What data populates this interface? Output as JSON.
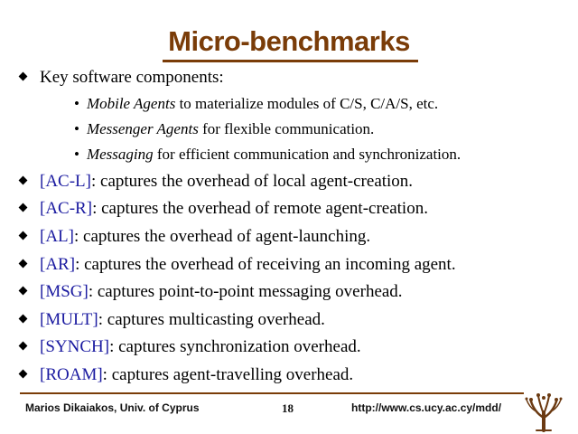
{
  "title": "Micro-benchmarks",
  "intro": "Key software components:",
  "sub_items": [
    {
      "term": "Mobile Agents",
      "text": " to materialize modules of C/S, C/A/S, etc."
    },
    {
      "term": "Messenger Agents",
      "text": " for flexible communication."
    },
    {
      "term": "Messaging",
      "text": " for efficient communication and synchronization."
    }
  ],
  "benchmarks": [
    {
      "key": "[AC-L]",
      "text": ": captures the overhead of local agent-creation."
    },
    {
      "key": "[AC-R]",
      "text": ": captures the overhead of remote agent-creation."
    },
    {
      "key": "[AL]",
      "text": ": captures the overhead of agent-launching."
    },
    {
      "key": "[AR]",
      "text": ": captures the overhead of receiving an incoming agent."
    },
    {
      "key": "[MSG]",
      "text": ": captures point-to-point messaging overhead."
    },
    {
      "key": "[MULT]",
      "text": ": captures multicasting overhead."
    },
    {
      "key": "[SYNCH]",
      "text": ": captures synchronization overhead."
    },
    {
      "key": "[ROAM]",
      "text": ": captures agent-travelling overhead."
    }
  ],
  "footer": {
    "author": "Marios Dikaiakos, Univ. of Cyprus",
    "page": "18",
    "url": "http://www.cs.ucy.ac.cy/mdd/"
  },
  "colors": {
    "title": "#7a3c08",
    "key": "#1a1aa0"
  },
  "icons": {
    "logo": "tree-logo-icon"
  }
}
